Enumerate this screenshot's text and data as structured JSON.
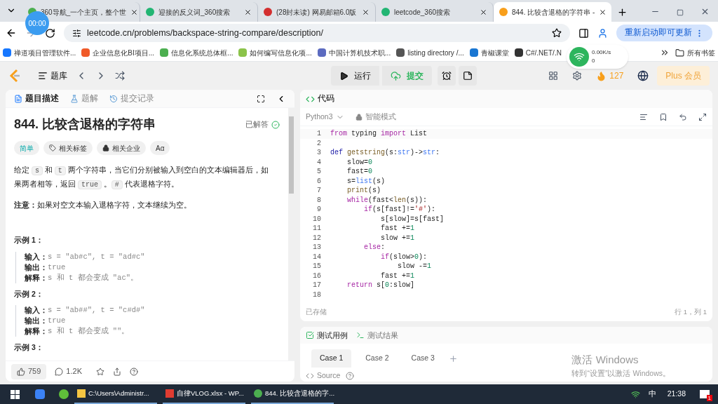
{
  "browser": {
    "tabs": [
      {
        "title": "360导航_一个主页，整个世",
        "kind": "nav",
        "selected": false
      },
      {
        "title": "迎接的反义词_360搜索",
        "kind": "search",
        "selected": false
      },
      {
        "title": "(28封未读) 网易邮箱6.0版",
        "kind": "mail",
        "selected": false
      },
      {
        "title": "leetcode_360搜索",
        "kind": "search",
        "selected": false
      },
      {
        "title": "844. 比较含退格的字符串 -",
        "kind": "leetcode",
        "selected": true
      }
    ],
    "url": "leetcode.cn/problems/backspace-string-compare/description/",
    "update_button": "重新启动即可更新",
    "bookmarks": [
      {
        "label": "禅道项目管理软件...",
        "color": "#1677ff"
      },
      {
        "label": "企业信息化BI项目...",
        "color": "#f05a28"
      },
      {
        "label": "信息化系统总体框...",
        "color": "#4caf50"
      },
      {
        "label": "如何编写信息化项...",
        "color": "#8bc34a"
      },
      {
        "label": "中国计算机技术职...",
        "color": "#5c6bc0"
      },
      {
        "label": "listing directory /...",
        "color": "#555555"
      },
      {
        "label": "青椒课堂",
        "color": "#1976d2"
      },
      {
        "label": "C#/.NET/.N",
        "color": "#333333"
      }
    ],
    "all_bookmarks": "所有书签",
    "recorder": "00:00",
    "net_widget": {
      "up": "0.00K/s",
      "down": "0"
    }
  },
  "header": {
    "library": "题库",
    "run": "运行",
    "submit": "提交",
    "streak": "127",
    "plus": "Plus 会员"
  },
  "problem": {
    "tabs": [
      {
        "label": "题目描述",
        "selected": true
      },
      {
        "label": "题解",
        "selected": false
      },
      {
        "label": "提交记录",
        "selected": false
      }
    ],
    "title": "844. 比较含退格的字符串",
    "status": "已解答",
    "tags": [
      {
        "label": "简单",
        "kind": "difficulty"
      },
      {
        "label": "相关标签",
        "kind": "tag"
      },
      {
        "label": "相关企业",
        "kind": "lock"
      },
      {
        "label": "Aα",
        "kind": "font"
      }
    ],
    "description": [
      {
        "kind": "text",
        "text": "给定 "
      },
      {
        "kind": "code",
        "text": "s"
      },
      {
        "kind": "text",
        "text": " 和 "
      },
      {
        "kind": "code",
        "text": "t"
      },
      {
        "kind": "text",
        "text": " 两个字符串，当它们分别被输入到空白的文本编辑器后，如果两者相等，返回 "
      },
      {
        "kind": "code",
        "text": "true"
      },
      {
        "kind": "text",
        "text": " 。"
      },
      {
        "kind": "code",
        "text": "#"
      },
      {
        "kind": "text",
        "text": " 代表退格字符。"
      }
    ],
    "note": "**注意：**如果对空文本输入退格字符，文本继续为空。",
    "examples": [
      {
        "title": "示例 1：",
        "lines": [
          {
            "label": "输入：",
            "value": "s = \"ab#c\", t = \"ad#c\""
          },
          {
            "label": "输出：",
            "value": "true"
          },
          {
            "label": "解释：",
            "value": "s 和 t 都会变成 \"ac\"。"
          }
        ]
      },
      {
        "title": "示例 2：",
        "lines": [
          {
            "label": "输入：",
            "value": "s = \"ab##\", t = \"c#d#\""
          },
          {
            "label": "输出：",
            "value": "true"
          },
          {
            "label": "解释：",
            "value": "s 和 t 都会变成 \"\"。"
          }
        ]
      },
      {
        "title": "示例 3："
      }
    ],
    "likes": "759",
    "comments": "1.2K"
  },
  "editor": {
    "title": "代码",
    "language": "Python3",
    "mode": "智能模式",
    "lines": [
      {
        "number": "1",
        "tokens": [
          {
            "kind": "kw",
            "text": "from"
          },
          {
            "kind": "p",
            "text": " typing "
          },
          {
            "kind": "kw",
            "text": "import"
          },
          {
            "kind": "p",
            "text": " List"
          }
        ]
      },
      {
        "number": "2"
      },
      {
        "number": "3",
        "tokens": [
          {
            "kind": "def",
            "text": "def "
          },
          {
            "kind": "fn",
            "text": "getstring"
          },
          {
            "kind": "p",
            "text": "(s:"
          },
          {
            "kind": "ty",
            "text": "str"
          },
          {
            "kind": "p",
            "text": ")->"
          },
          {
            "kind": "ty",
            "text": "str"
          },
          {
            "kind": "p",
            "text": ":"
          }
        ]
      },
      {
        "number": "4",
        "tokens": [
          {
            "kind": "p",
            "text": "    slow="
          },
          {
            "kind": "num",
            "text": "0"
          }
        ]
      },
      {
        "number": "5",
        "tokens": [
          {
            "kind": "p",
            "text": "    fast="
          },
          {
            "kind": "num",
            "text": "0"
          }
        ]
      },
      {
        "number": "6",
        "tokens": [
          {
            "kind": "p",
            "text": "    s="
          },
          {
            "kind": "ty",
            "text": "list"
          },
          {
            "kind": "p",
            "text": "(s)"
          }
        ]
      },
      {
        "number": "7",
        "tokens": [
          {
            "kind": "fn",
            "text": "    print"
          },
          {
            "kind": "p",
            "text": "(s)"
          }
        ]
      },
      {
        "number": "8",
        "tokens": [
          {
            "kind": "kw",
            "text": "    while"
          },
          {
            "kind": "p",
            "text": "(fast<"
          },
          {
            "kind": "fn",
            "text": "len"
          },
          {
            "kind": "p",
            "text": "(s)):"
          }
        ]
      },
      {
        "number": "9",
        "tokens": [
          {
            "kind": "kw",
            "text": "        if"
          },
          {
            "kind": "p",
            "text": "(s[fast]!="
          },
          {
            "kind": "str",
            "text": "'#'"
          },
          {
            "kind": "p",
            "text": "):"
          }
        ]
      },
      {
        "number": "10",
        "tokens": [
          {
            "kind": "p",
            "text": "            s[slow]=s[fast]"
          }
        ]
      },
      {
        "number": "11",
        "tokens": [
          {
            "kind": "p",
            "text": "            fast +="
          },
          {
            "kind": "num",
            "text": "1"
          }
        ]
      },
      {
        "number": "12",
        "tokens": [
          {
            "kind": "p",
            "text": "            slow +="
          },
          {
            "kind": "num",
            "text": "1"
          }
        ]
      },
      {
        "number": "13",
        "tokens": [
          {
            "kind": "kw",
            "text": "        else"
          },
          {
            "kind": "p",
            "text": ":"
          }
        ]
      },
      {
        "number": "14",
        "tokens": [
          {
            "kind": "kw",
            "text": "            if"
          },
          {
            "kind": "p",
            "text": "(slow>"
          },
          {
            "kind": "num",
            "text": "0"
          },
          {
            "kind": "p",
            "text": "):"
          }
        ]
      },
      {
        "number": "15",
        "tokens": [
          {
            "kind": "p",
            "text": "                slow -="
          },
          {
            "kind": "num",
            "text": "1"
          }
        ]
      },
      {
        "number": "16",
        "tokens": [
          {
            "kind": "p",
            "text": "            fast +="
          },
          {
            "kind": "num",
            "text": "1"
          }
        ]
      },
      {
        "number": "17",
        "tokens": [
          {
            "kind": "kw",
            "text": "    return"
          },
          {
            "kind": "p",
            "text": " s["
          },
          {
            "kind": "num",
            "text": "0"
          },
          {
            "kind": "p",
            "text": ":slow]"
          }
        ]
      },
      {
        "number": "18"
      }
    ],
    "saved": "已存储",
    "position": "行 1，列 1"
  },
  "tests": {
    "tabs": [
      {
        "label": "测试用例",
        "selected": true
      },
      {
        "label": "测试结果",
        "selected": false
      }
    ],
    "cases": [
      {
        "label": "Case 1",
        "selected": true
      },
      {
        "label": "Case 2",
        "selected": false
      },
      {
        "label": "Case 3",
        "selected": false
      }
    ],
    "source": "Source"
  },
  "activation": {
    "title": "激活 Windows",
    "hint": "转到“设置”以激活 Windows。"
  },
  "taskbar": {
    "apps": [
      {
        "label": "C:\\Users\\Administr...",
        "kind": "folder"
      },
      {
        "label": "自律VLOG.xlsx - WP...",
        "kind": "wps"
      },
      {
        "label": "844. 比较含退格的字...",
        "kind": "chrome"
      }
    ],
    "ime": "中",
    "time": "21:38",
    "badge": "1"
  }
}
